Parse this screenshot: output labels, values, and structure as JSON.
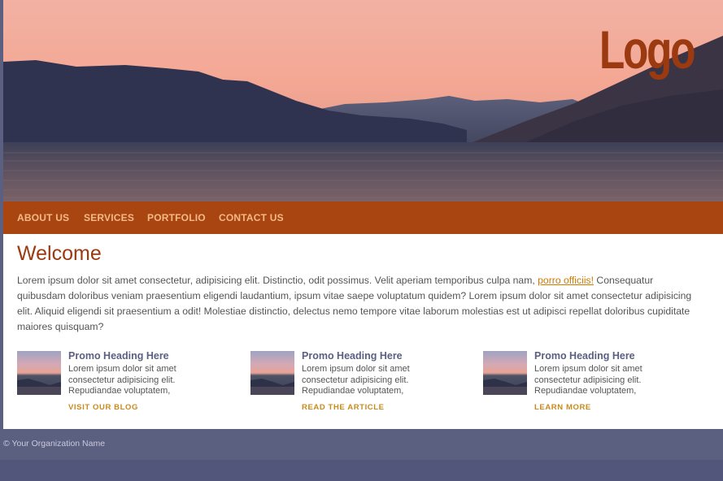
{
  "header": {
    "logo_text": "Logo"
  },
  "nav": {
    "items": [
      {
        "label": "ABOUT US"
      },
      {
        "label": "SERVICES"
      },
      {
        "label": "PORTFOLIO"
      },
      {
        "label": "CONTACT US"
      }
    ],
    "text_color": "#f4b987",
    "background": "#a84510"
  },
  "main": {
    "title": "Welcome",
    "intro_before_link": "Lorem ipsum dolor sit amet consectetur, adipisicing elit. Distinctio, odit possimus. Velit aperiam temporibus culpa nam, ",
    "intro_link": "porro officiis!",
    "intro_after_link": " Consequatur quibusdam doloribus veniam praesentium eligendi laudantium, ipsum vitae saepe voluptatum quidem? Lorem ipsum dolor sit amet consectetur adipisicing elit. Aliquid eligendi sit praesentium a odit! Molestiae distinctio, delectus nemo tempore vitae laborum molestias est ut adipisci repellat doloribus cupiditate maiores quisquam?",
    "promos": [
      {
        "heading": "Promo Heading Here",
        "text": "Lorem ipsum dolor sit amet consectetur adipisicing elit. Repudiandae voluptatem,",
        "link": "VISIT OUR BLOG"
      },
      {
        "heading": "Promo Heading Here",
        "text": "Lorem ipsum dolor sit amet consectetur adipisicing elit. Repudiandae voluptatem,",
        "link": "READ THE ARTICLE"
      },
      {
        "heading": "Promo Heading Here",
        "text": "Lorem ipsum dolor sit amet consectetur adipisicing elit. Repudiandae voluptatem,",
        "link": "LEARN MORE"
      }
    ]
  },
  "footer": {
    "copyright": "© Your Organization Name"
  },
  "colors": {
    "accent": "#a84510",
    "logo": "#9b3a10",
    "link": "#cc7a00",
    "footer": "#5b5f80"
  }
}
